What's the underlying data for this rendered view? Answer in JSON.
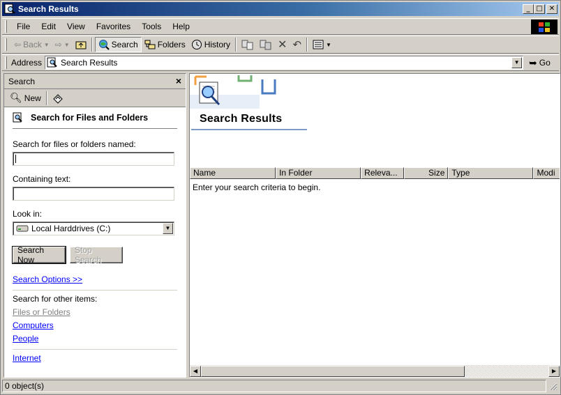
{
  "window": {
    "title": "Search Results"
  },
  "titlebar": {
    "min": "_",
    "max": "□",
    "close": "✕"
  },
  "menubar": {
    "items": [
      "File",
      "Edit",
      "View",
      "Favorites",
      "Tools",
      "Help"
    ]
  },
  "toolbar": {
    "back": "Back",
    "search": "Search",
    "folders": "Folders",
    "history": "History"
  },
  "address": {
    "label": "Address",
    "value": "Search Results",
    "go": "Go"
  },
  "search_pane": {
    "title": "Search",
    "new_label": "New",
    "heading": "Search for Files and Folders",
    "named_label": "Search for files or folders named:",
    "named_value": "",
    "containing_label": "Containing text:",
    "containing_value": "",
    "lookin_label": "Look in:",
    "lookin_value": "Local Harddrives (C:)",
    "search_now": "Search Now",
    "stop_search": "Stop Search",
    "options_link": "Search Options >>",
    "other_label": "Search for other items:",
    "other_items": [
      "Files or Folders",
      "Computers",
      "People"
    ],
    "internet": "Internet"
  },
  "results": {
    "title": "Search Results",
    "columns": [
      "Name",
      "In Folder",
      "Releva...",
      "Size",
      "Type",
      "Modi"
    ],
    "empty_message": "Enter your search criteria to begin."
  },
  "statusbar": {
    "text": "0 object(s)"
  },
  "colors": {
    "titlebar_start": "#0a246a",
    "titlebar_end": "#a6caf0",
    "face": "#d4d0c8",
    "link": "#0000ff"
  }
}
